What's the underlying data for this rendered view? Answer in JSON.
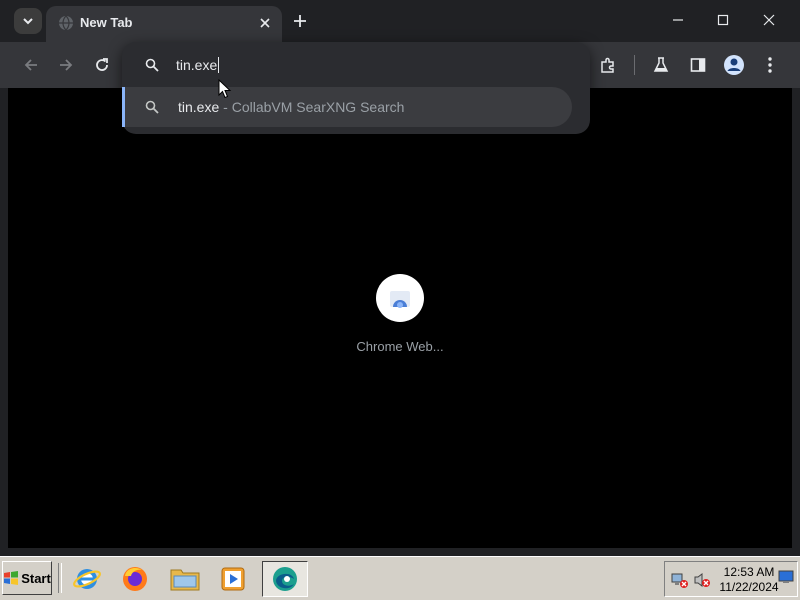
{
  "titlebar": {
    "tab_title": "New Tab"
  },
  "omnibox": {
    "input_value": "tin.exe",
    "suggestions": [
      {
        "query": "tin.exe",
        "separator": " - ",
        "engine": "CollabVM SearXNG Search"
      }
    ]
  },
  "content": {
    "loading_label": "Chrome Web..."
  },
  "taskbar": {
    "start_label": "Start",
    "clock_time": "12:53 AM",
    "clock_date": "11/22/2024"
  },
  "colors": {
    "chrome_dark": "#202124",
    "toolbar": "#35363a",
    "accent_blue": "#8ab4f8",
    "taskbar": "#d4d0c8"
  },
  "icons": {
    "tab_search": "chevron-down-icon",
    "favicon": "globe-icon",
    "tab_close": "close-icon",
    "new_tab": "plus-icon",
    "back": "back-arrow-icon",
    "forward": "forward-arrow-icon",
    "reload": "reload-icon",
    "extensions": "puzzle-icon",
    "labs": "flask-icon",
    "side_panel": "side-panel-icon",
    "profile": "avatar-icon",
    "menu": "kebab-menu-icon"
  }
}
